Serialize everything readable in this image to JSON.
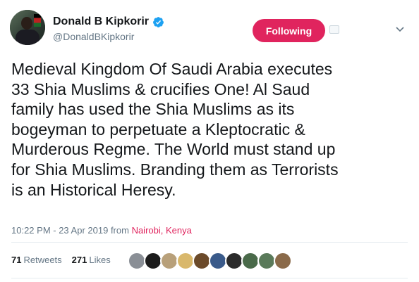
{
  "author": {
    "display_name": "Donald B Kipkorir",
    "handle": "@DonaldBKipkorir",
    "verified": true
  },
  "follow_button": {
    "label": "Following"
  },
  "tweet": {
    "text": "Medieval Kingdom Of Saudi Arabia executes\n33 Shia Muslims & crucifies One! Al Saud\nfamily has used the Shia Muslims as its\nbogeyman to perpetuate a Kleptocratic &\nMurderous Regme. The World must stand up\nfor Shia Muslims. Branding them as Terrorists\nis an Historical Heresy.",
    "timestamp": "10:22 PM - 23 Apr 2019",
    "from_label": "from",
    "location": "Nairobi, Kenya"
  },
  "stats": {
    "retweets_count": "71",
    "retweets_label": "Retweets",
    "likes_count": "271",
    "likes_label": "Likes"
  },
  "likers": [
    {
      "color": "#8a8f96"
    },
    {
      "color": "#1c1c1c"
    },
    {
      "color": "#b8a07a"
    },
    {
      "color": "#d9b86c"
    },
    {
      "color": "#6b4a2a"
    },
    {
      "color": "#3a5a8a"
    },
    {
      "color": "#2b2b2b"
    },
    {
      "color": "#4a6a4a"
    },
    {
      "color": "#5a7a5a"
    },
    {
      "color": "#8a6a4a"
    }
  ],
  "colors": {
    "accent": "#e0245e",
    "verified": "#1da1f2",
    "muted": "#657786"
  }
}
